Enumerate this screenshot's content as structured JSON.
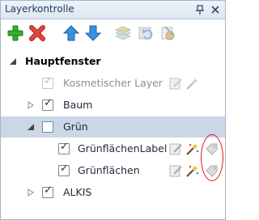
{
  "window": {
    "title": "Layerkontrolle",
    "buttons": [
      "pin-icon",
      "close-icon"
    ]
  },
  "toolbar": {
    "tools": [
      {
        "name": "add-layer-icon",
        "color": "#2e9d2a"
      },
      {
        "name": "remove-layer-icon",
        "color": "#d8332a"
      },
      {
        "name": "move-up-icon",
        "color": "#2c7fd4"
      },
      {
        "name": "move-down-icon",
        "color": "#2c7fd4"
      },
      {
        "name": "layers-icon",
        "enabled": false
      },
      {
        "name": "refresh-icon",
        "enabled": false
      },
      {
        "name": "style-icon",
        "enabled": false
      }
    ]
  },
  "tree": {
    "root": {
      "label": "Hauptfenster",
      "expanded": true
    },
    "items": [
      {
        "label": "Kosmetischer Layer",
        "checked": true,
        "enabled": false,
        "level": 1
      },
      {
        "label": "Baum",
        "checked": true,
        "expandable": true,
        "expanded": false,
        "level": 1
      },
      {
        "label": "Grün",
        "checked": false,
        "expandable": true,
        "expanded": true,
        "level": 1,
        "selected": true
      },
      {
        "label": "GrünflächenLabel",
        "checked": true,
        "level": 2
      },
      {
        "label": "Grünflächen",
        "checked": true,
        "level": 2
      },
      {
        "label": "ALKIS",
        "checked": true,
        "expandable": true,
        "expanded": false,
        "level": 1
      }
    ]
  },
  "colors": {
    "selection": "#cbd6e6",
    "annotation": "#e0151b"
  }
}
